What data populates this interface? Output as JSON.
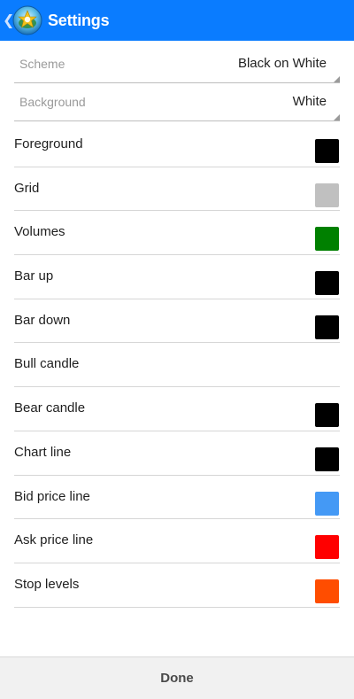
{
  "app": {
    "title": "Settings",
    "back_glyph": "❮",
    "icon": "metatrader-logo-icon"
  },
  "scheme": {
    "label": "Scheme",
    "value": "Black on White"
  },
  "background": {
    "label": "Background",
    "value": "White"
  },
  "colors": [
    {
      "label": "Foreground",
      "color": "#000000",
      "show_swatch": true
    },
    {
      "label": "Grid",
      "color": "#c0c0c0",
      "show_swatch": true
    },
    {
      "label": "Volumes",
      "color": "#008000",
      "show_swatch": true
    },
    {
      "label": "Bar up",
      "color": "#000000",
      "show_swatch": true
    },
    {
      "label": "Bar down",
      "color": "#000000",
      "show_swatch": true
    },
    {
      "label": "Bull candle",
      "color": "#ffffff",
      "show_swatch": false
    },
    {
      "label": "Bear candle",
      "color": "#000000",
      "show_swatch": true
    },
    {
      "label": "Chart line",
      "color": "#000000",
      "show_swatch": true
    },
    {
      "label": "Bid price line",
      "color": "#4499f5",
      "show_swatch": true
    },
    {
      "label": "Ask price line",
      "color": "#ff0000",
      "show_swatch": true
    },
    {
      "label": "Stop levels",
      "color": "#ff4d00",
      "show_swatch": true
    }
  ],
  "footer": {
    "done_label": "Done"
  },
  "theme": {
    "action_bar": "#0a7cff",
    "divider": "#d6d6d6",
    "footer_bg": "#f1f1f1"
  }
}
